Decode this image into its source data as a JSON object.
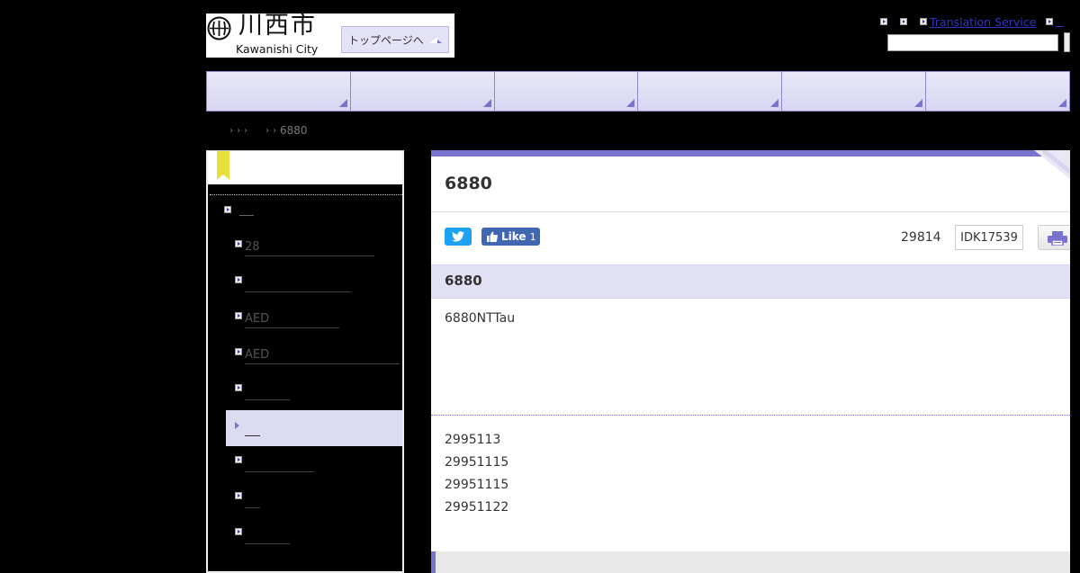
{
  "header": {
    "logo_jp": "川西市",
    "logo_en": "Kawanishi City",
    "top_page_label": "トップページへ"
  },
  "utility": {
    "translation_label": "Translation Service"
  },
  "breadcrumb": {
    "current": "6880"
  },
  "sidebar": {
    "items": [
      {
        "label": "28"
      },
      {
        "label": ""
      },
      {
        "label": "AED"
      },
      {
        "label": "AED"
      },
      {
        "label": ""
      },
      {
        "label": "",
        "active": true
      },
      {
        "label": ""
      },
      {
        "label": ""
      },
      {
        "label": ""
      }
    ]
  },
  "main": {
    "title": "6880",
    "facebook_like_label": "Like",
    "facebook_like_count": "1",
    "page_number": "29814",
    "page_code": "IDK17539",
    "section_title": "6880",
    "body_text": "6880NTTau",
    "dates": [
      "2995113",
      "29951115",
      "29951115",
      "29951122"
    ]
  },
  "colors": {
    "accent": "#7a72cf",
    "nav_bg": "#e1dff5",
    "section_bg": "#e2e0f4",
    "twitter": "#1da1f2",
    "facebook": "#4267b2"
  },
  "icons": [
    "kawanishi-logo-icon",
    "arrow-up-icon",
    "twitter-icon",
    "facebook-like-icon",
    "print-icon",
    "ribbon-icon"
  ]
}
